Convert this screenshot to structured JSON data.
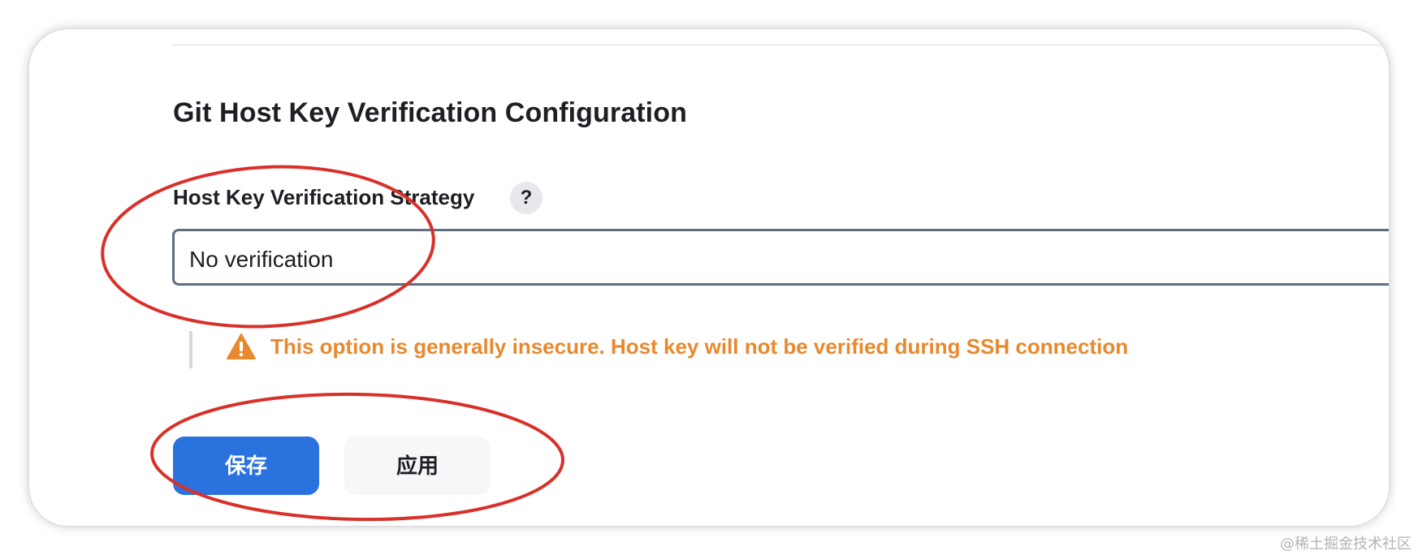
{
  "section": {
    "title": "Git Host Key Verification Configuration"
  },
  "field": {
    "label": "Host Key Verification Strategy",
    "help_symbol": "?",
    "selected_value": "No verification"
  },
  "warning": {
    "icon": "warning-triangle-icon",
    "text": "This option is generally insecure. Host key will not be verified during SSH connection",
    "color": "#e8892e"
  },
  "buttons": {
    "save_label": "保存",
    "apply_label": "应用"
  },
  "colors": {
    "primary_button": "#2a72de",
    "select_border": "#5f6f7f",
    "annotation_red": "#d8312a"
  },
  "watermark": {
    "text": "@稀土掘金技术社区"
  }
}
